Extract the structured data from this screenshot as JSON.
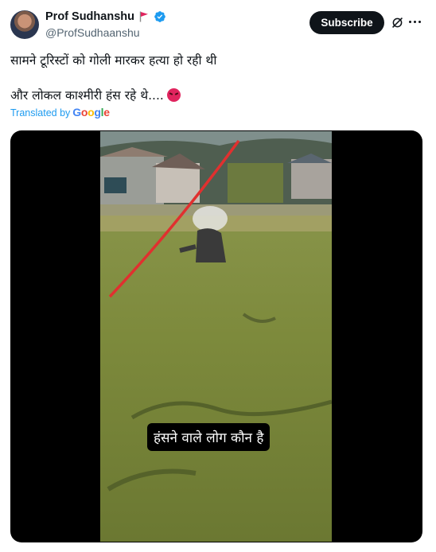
{
  "header": {
    "display_name": "Prof Sudhanshu",
    "handle": "@ProfSudhaanshu",
    "subscribe_label": "Subscribe"
  },
  "post": {
    "line1": "सामने टूरिस्टों को गोली मारकर हत्या हो रही थी",
    "line2": "और लोकल काश्मीरी हंस रहे थे....",
    "translated_prefix": "Translated by",
    "translated_brand": "Google"
  },
  "media": {
    "caption": "हंसने वाले लोग कौन है"
  },
  "icons": {
    "flag": "red-flag-icon",
    "verified": "verified-badge-icon",
    "grok": "grok-icon",
    "more": "more-icon",
    "emoji": "angry-face-icon"
  },
  "colors": {
    "accent": "#1d9bf0",
    "subscribe_bg": "#0f1419",
    "flag": "#e0245e"
  }
}
